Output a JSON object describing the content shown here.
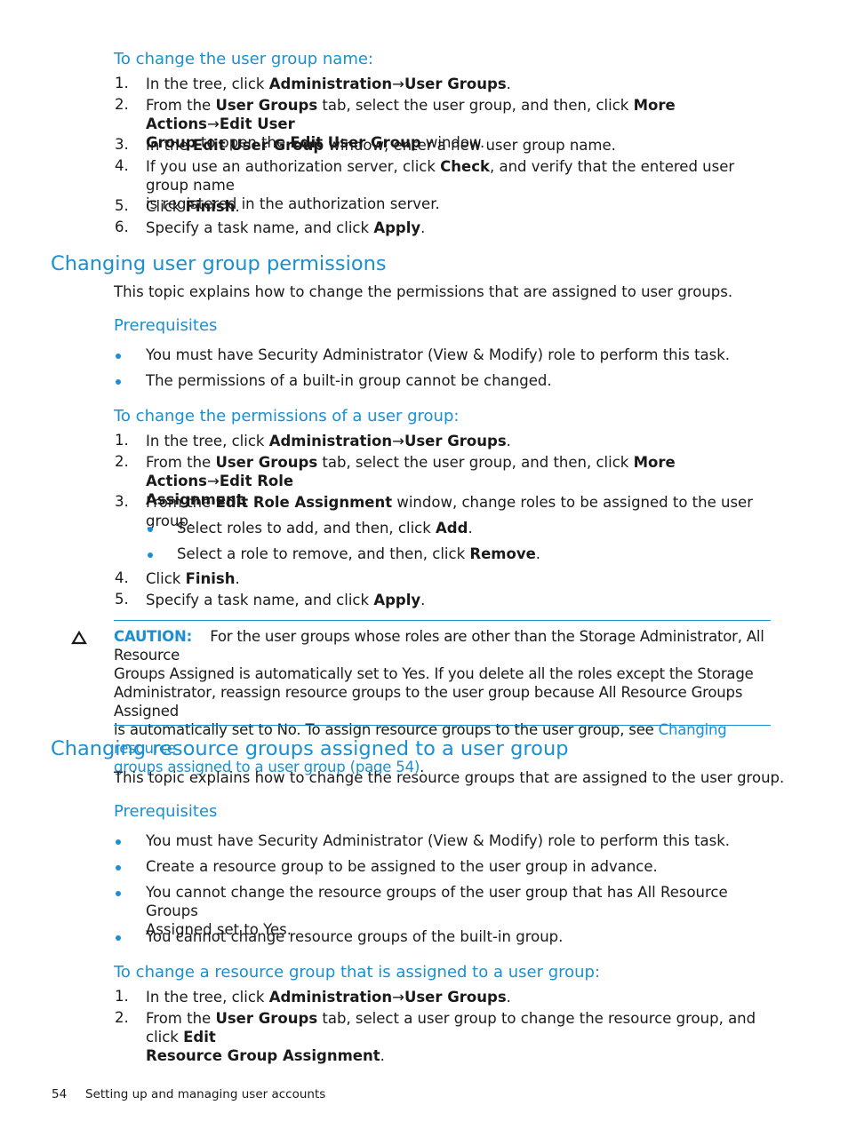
{
  "section1": {
    "procedure_title": "To change the user group name:",
    "steps": [
      {
        "num": "1.",
        "parts": [
          {
            "t": "In the tree, click "
          },
          {
            "b": "Administration"
          },
          {
            "t": "→"
          },
          {
            "b": "User Groups"
          },
          {
            "t": "."
          }
        ]
      },
      {
        "num": "2.",
        "line1": [
          {
            "t": "From the "
          },
          {
            "b": "User Groups"
          },
          {
            "t": " tab, select the user group, and then, click "
          },
          {
            "b": "More Actions"
          },
          {
            "t": "→"
          },
          {
            "b": "Edit User"
          }
        ],
        "line2": [
          {
            "b": "Group"
          },
          {
            "t": " to open the "
          },
          {
            "b": "Edit User Group"
          },
          {
            "t": " window."
          }
        ]
      },
      {
        "num": "3.",
        "parts": [
          {
            "t": "In the "
          },
          {
            "b": "Edit User Group"
          },
          {
            "t": " window, enter a new user group name."
          }
        ]
      },
      {
        "num": "4.",
        "line1": [
          {
            "t": "If you use an authorization server, click "
          },
          {
            "b": "Check"
          },
          {
            "t": ", and verify that the entered user group name"
          }
        ],
        "line2": [
          {
            "t": "is registered in the authorization server."
          }
        ]
      },
      {
        "num": "5.",
        "parts": [
          {
            "t": "Click "
          },
          {
            "b": "Finish"
          },
          {
            "t": "."
          }
        ]
      },
      {
        "num": "6.",
        "parts": [
          {
            "t": "Specify a task name, and click "
          },
          {
            "b": "Apply"
          },
          {
            "t": "."
          }
        ]
      }
    ]
  },
  "section2": {
    "heading": "Changing user group permissions",
    "intro": "This topic explains how to change the permissions that are assigned to user groups.",
    "prereq_title": "Prerequisites",
    "prereqs": [
      "You must have Security Administrator (View & Modify) role to perform this task.",
      "The permissions of a built-in group cannot be changed."
    ],
    "procedure_title": "To change the permissions of a user group:",
    "steps": [
      {
        "num": "1.",
        "parts": [
          {
            "t": "In the tree, click "
          },
          {
            "b": "Administration"
          },
          {
            "t": "→"
          },
          {
            "b": "User Groups"
          },
          {
            "t": "."
          }
        ]
      },
      {
        "num": "2.",
        "line1": [
          {
            "t": "From the "
          },
          {
            "b": "User Groups"
          },
          {
            "t": " tab, select the user group, and then, click "
          },
          {
            "b": "More Actions"
          },
          {
            "t": "→"
          },
          {
            "b": "Edit Role"
          }
        ],
        "line2": [
          {
            "b": "Assignment"
          },
          {
            "t": "."
          }
        ]
      },
      {
        "num": "3.",
        "parts": [
          {
            "t": "From the "
          },
          {
            "b": "Edit Role Assignment"
          },
          {
            "t": " window, change roles to be assigned to the user group."
          }
        ]
      },
      {
        "num": "4.",
        "parts": [
          {
            "t": "Click "
          },
          {
            "b": "Finish"
          },
          {
            "t": "."
          }
        ]
      },
      {
        "num": "5.",
        "parts": [
          {
            "t": "Specify a task name, and click "
          },
          {
            "b": "Apply"
          },
          {
            "t": "."
          }
        ]
      }
    ],
    "substeps": [
      [
        {
          "t": "Select roles to add, and then, click "
        },
        {
          "b": "Add"
        },
        {
          "t": "."
        }
      ],
      [
        {
          "t": "Select a role to remove, and then, click "
        },
        {
          "b": "Remove"
        },
        {
          "t": "."
        }
      ]
    ],
    "caution": {
      "label": "CAUTION:",
      "lines": [
        "For the user groups whose roles are other than the Storage Administrator, All Resource",
        "Groups Assigned is automatically set to Yes. If you delete all the roles except the Storage",
        "Administrator, reassign resource groups to the user group because All Resource Groups Assigned",
        "is automatically set to No. To assign resource groups to the user group, see "
      ],
      "link_part1": "Changing resource",
      "link_part2": "groups assigned to a user group (page 54)",
      "end": "."
    }
  },
  "section3": {
    "heading": "Changing resource groups assigned to a user group",
    "intro": "This topic explains how to change the resource groups that are assigned to the user group.",
    "prereq_title": "Prerequisites",
    "prereqs": [
      {
        "line1": "You must have Security Administrator (View & Modify) role to perform this task."
      },
      {
        "line1": "Create a resource group to be assigned to the user group in advance."
      },
      {
        "line1": "You cannot change the resource groups of the user group that has All Resource Groups",
        "line2": "Assigned set to Yes."
      },
      {
        "line1": "You cannot change resource groups of the built-in group."
      }
    ],
    "procedure_title": "To change a resource group that is assigned to a user group:",
    "steps": [
      {
        "num": "1.",
        "parts": [
          {
            "t": "In the tree, click "
          },
          {
            "b": "Administration"
          },
          {
            "t": "→"
          },
          {
            "b": "User Groups"
          },
          {
            "t": "."
          }
        ]
      },
      {
        "num": "2.",
        "line1": [
          {
            "t": "From the "
          },
          {
            "b": "User Groups"
          },
          {
            "t": " tab, select a user group to change the resource group, and click "
          },
          {
            "b": "Edit"
          }
        ],
        "line2": [
          {
            "b": "Resource Group Assignment"
          },
          {
            "t": "."
          }
        ]
      }
    ]
  },
  "footer": {
    "page_number": "54",
    "chapter": "Setting up and managing user accounts"
  }
}
